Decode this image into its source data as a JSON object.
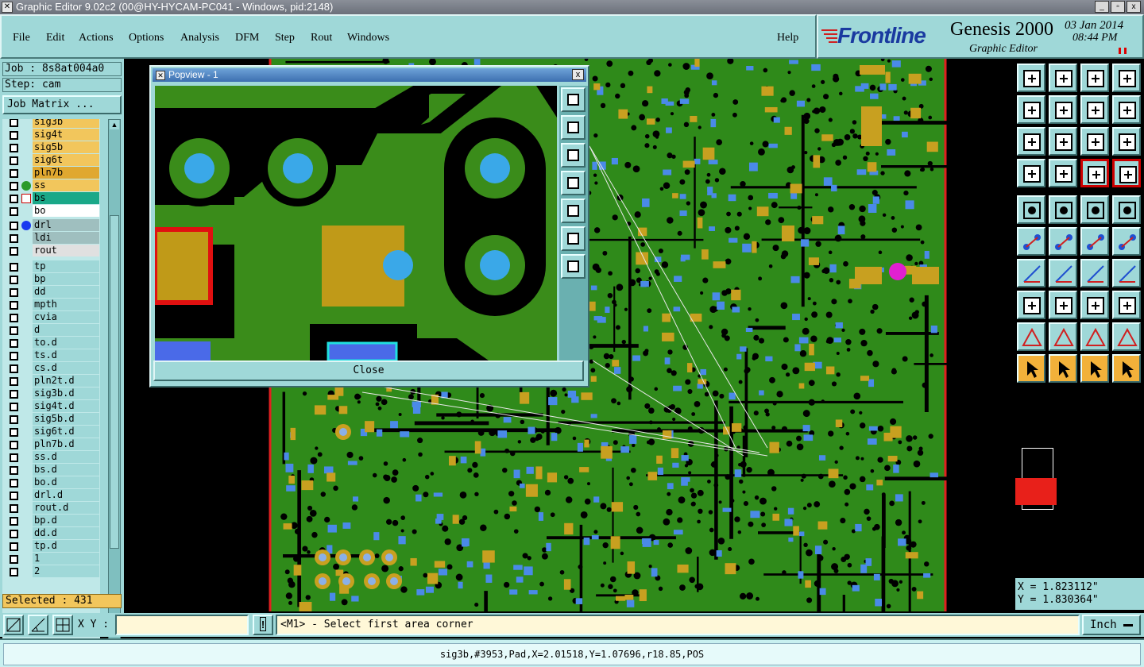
{
  "window": {
    "title": "Graphic Editor 9.02c2 (00@HY-HYCAM-PC041 - Windows, pid:2148)",
    "buttons": [
      "_",
      "▫",
      "x"
    ]
  },
  "menu": [
    "File",
    "Edit",
    "Actions",
    "Options",
    "Analysis",
    "DFM",
    "Step",
    "Rout",
    "Windows"
  ],
  "help_label": "Help",
  "brand": {
    "logo": "Frontline",
    "product": "Genesis 2000",
    "subtitle": "Graphic Editor",
    "date": "03 Jan 2014",
    "time": "08:44 PM"
  },
  "job": {
    "job_label": "Job : 8s8at004a0",
    "step_label": "Step: cam",
    "matrix_button": "Job Matrix ..."
  },
  "layers": [
    {
      "name": "sig3b",
      "color": "#f2c65c"
    },
    {
      "name": "sig4t",
      "color": "#f2c65c"
    },
    {
      "name": "sig5b",
      "color": "#f2c65c"
    },
    {
      "name": "sig6t",
      "color": "#f2c65c"
    },
    {
      "name": "pln7b",
      "color": "#e0a830"
    },
    {
      "name": "ss",
      "color": "#f2c65c"
    },
    {
      "name": "bs",
      "color": "#1aa888"
    },
    {
      "name": "bo",
      "color": "#ffffff"
    },
    {
      "name": "drl",
      "color": "#9fbfbf"
    },
    {
      "name": "ldi",
      "color": "#9fbfbf"
    },
    {
      "name": "rout",
      "color": "#e0e0e0"
    },
    {
      "name": "tp",
      "color": "#9fd8d8"
    },
    {
      "name": "bp",
      "color": "#9fd8d8"
    },
    {
      "name": "dd",
      "color": "#9fd8d8"
    },
    {
      "name": "mpth",
      "color": "#9fd8d8"
    },
    {
      "name": "cvia",
      "color": "#9fd8d8"
    },
    {
      "name": "d",
      "color": "#9fd8d8"
    },
    {
      "name": "to.d",
      "color": "#9fd8d8"
    },
    {
      "name": "ts.d",
      "color": "#9fd8d8"
    },
    {
      "name": "cs.d",
      "color": "#9fd8d8"
    },
    {
      "name": "pln2t.d",
      "color": "#9fd8d8"
    },
    {
      "name": "sig3b.d",
      "color": "#9fd8d8"
    },
    {
      "name": "sig4t.d",
      "color": "#9fd8d8"
    },
    {
      "name": "sig5b.d",
      "color": "#9fd8d8"
    },
    {
      "name": "sig6t.d",
      "color": "#9fd8d8"
    },
    {
      "name": "pln7b.d",
      "color": "#9fd8d8"
    },
    {
      "name": "ss.d",
      "color": "#9fd8d8"
    },
    {
      "name": "bs.d",
      "color": "#9fd8d8"
    },
    {
      "name": "bo.d",
      "color": "#9fd8d8"
    },
    {
      "name": "drl.d",
      "color": "#9fd8d8"
    },
    {
      "name": "rout.d",
      "color": "#9fd8d8"
    },
    {
      "name": "bp.d",
      "color": "#9fd8d8"
    },
    {
      "name": "dd.d",
      "color": "#9fd8d8"
    },
    {
      "name": "tp.d",
      "color": "#9fd8d8"
    },
    {
      "name": "1",
      "color": "#9fd8d8"
    },
    {
      "name": "2",
      "color": "#9fd8d8"
    }
  ],
  "selected_label": "Selected : 431",
  "popview": {
    "title": "Popview - 1",
    "close_label": "Close"
  },
  "coords": {
    "x": "X = 1.823112\"",
    "y": "Y = 1.830364\""
  },
  "bottom": {
    "xy_label": "X Y :",
    "xy_value": "",
    "prompt": "<M1> - Select first area corner",
    "unit": "Inch"
  },
  "status": "sig3b,#3953,Pad,X=2.01518,Y=1.07696,r18.85,POS",
  "colors": {
    "panel": "#9fd8d8",
    "board": "#2f8a1a",
    "copper": "#c8a020",
    "pad_blue": "#4a8ae8"
  }
}
